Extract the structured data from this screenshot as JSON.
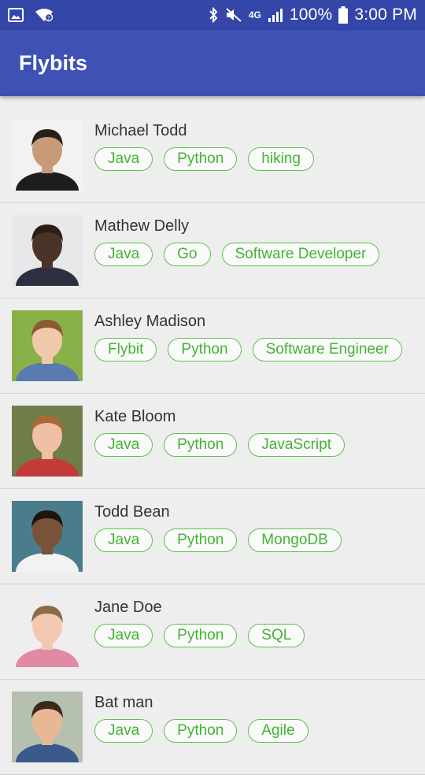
{
  "status_bar": {
    "battery": "100%",
    "time": "3:00 PM",
    "network": "4G",
    "icons": [
      "image-icon",
      "wifi-icon",
      "bluetooth-icon",
      "mute-icon",
      "signal-icon",
      "battery-icon"
    ]
  },
  "app_bar": {
    "title": "Flybits"
  },
  "colors": {
    "app_bar": "#3f51b5",
    "status_bar": "#3446a8",
    "tag": "#43b334"
  },
  "people": [
    {
      "name": "Michael Todd",
      "tags": [
        "Java",
        "Python",
        "hiking"
      ]
    },
    {
      "name": "Mathew Delly",
      "tags": [
        "Java",
        "Go",
        "Software Developer"
      ]
    },
    {
      "name": "Ashley Madison",
      "tags": [
        "Flybit",
        "Python",
        "Software Engineer"
      ]
    },
    {
      "name": "Kate Bloom",
      "tags": [
        "Java",
        "Python",
        "JavaScript"
      ]
    },
    {
      "name": "Todd Bean",
      "tags": [
        "Java",
        "Python",
        "MongoDB"
      ]
    },
    {
      "name": "Jane Doe",
      "tags": [
        "Java",
        "Python",
        "SQL"
      ]
    },
    {
      "name": "Bat man",
      "tags": [
        "Java",
        "Python",
        "Agile"
      ]
    }
  ]
}
